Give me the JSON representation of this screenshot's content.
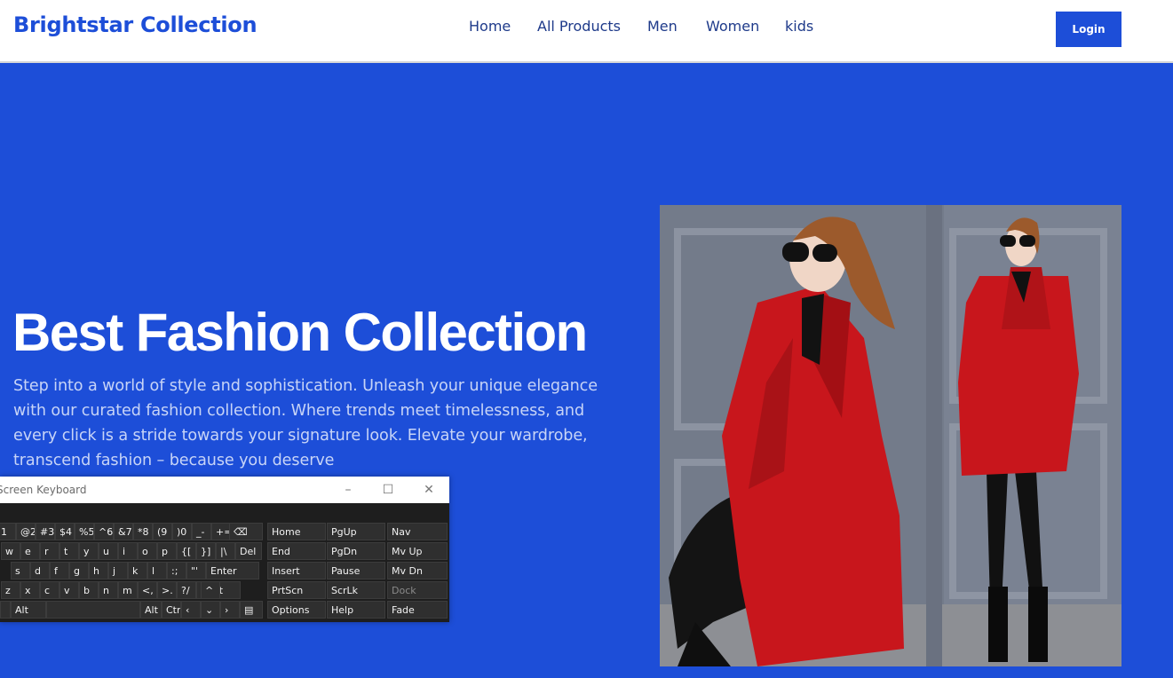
{
  "header": {
    "brand": "Brightstar Collection",
    "nav": [
      "Home",
      "All Products",
      "Men",
      "Women",
      "kids"
    ],
    "login_label": "Login"
  },
  "hero": {
    "title": "Best Fashion Collection",
    "text": "Step into a world of style and sophistication. Unleash your unique elegance with our curated fashion collection. Where trends meet timelessness, and every click is a stride towards your signature look. Elevate your wardrobe, transcend fashion – because you deserve"
  },
  "osk": {
    "title": "Screen Keyboard",
    "controls": [
      "–",
      "☐",
      "✕"
    ],
    "row1": [
      "1",
      "@2",
      "#3",
      "$4",
      "%5",
      "^6",
      "&7",
      "*8",
      "(9",
      ")0",
      "_-",
      "+="
    ],
    "row2": [
      "w",
      "e",
      "r",
      "t",
      "y",
      "u",
      "i",
      "o",
      "p",
      "{[",
      "}]",
      "|\\",
      "Del"
    ],
    "row3": [
      "s",
      "d",
      "f",
      "g",
      "h",
      "j",
      "k",
      "l",
      ":;",
      "\"'",
      "Enter"
    ],
    "row4": [
      "z",
      "x",
      "c",
      "v",
      "b",
      "n",
      "m",
      "<,",
      ">.",
      "?/",
      "Shift"
    ],
    "row5": [
      "Alt",
      "Alt",
      "Ctr"
    ],
    "nav": [
      [
        "Home",
        "PgUp",
        "Nav"
      ],
      [
        "End",
        "PgDn",
        "Mv Up"
      ],
      [
        "Insert",
        "Pause",
        "Mv Dn"
      ],
      [
        "PrtScn",
        "ScrLk",
        "Dock"
      ],
      [
        "Options",
        "Help",
        "Fade"
      ]
    ]
  },
  "colors": {
    "primary": "#1d4ed8",
    "coat": "#c8161c"
  }
}
